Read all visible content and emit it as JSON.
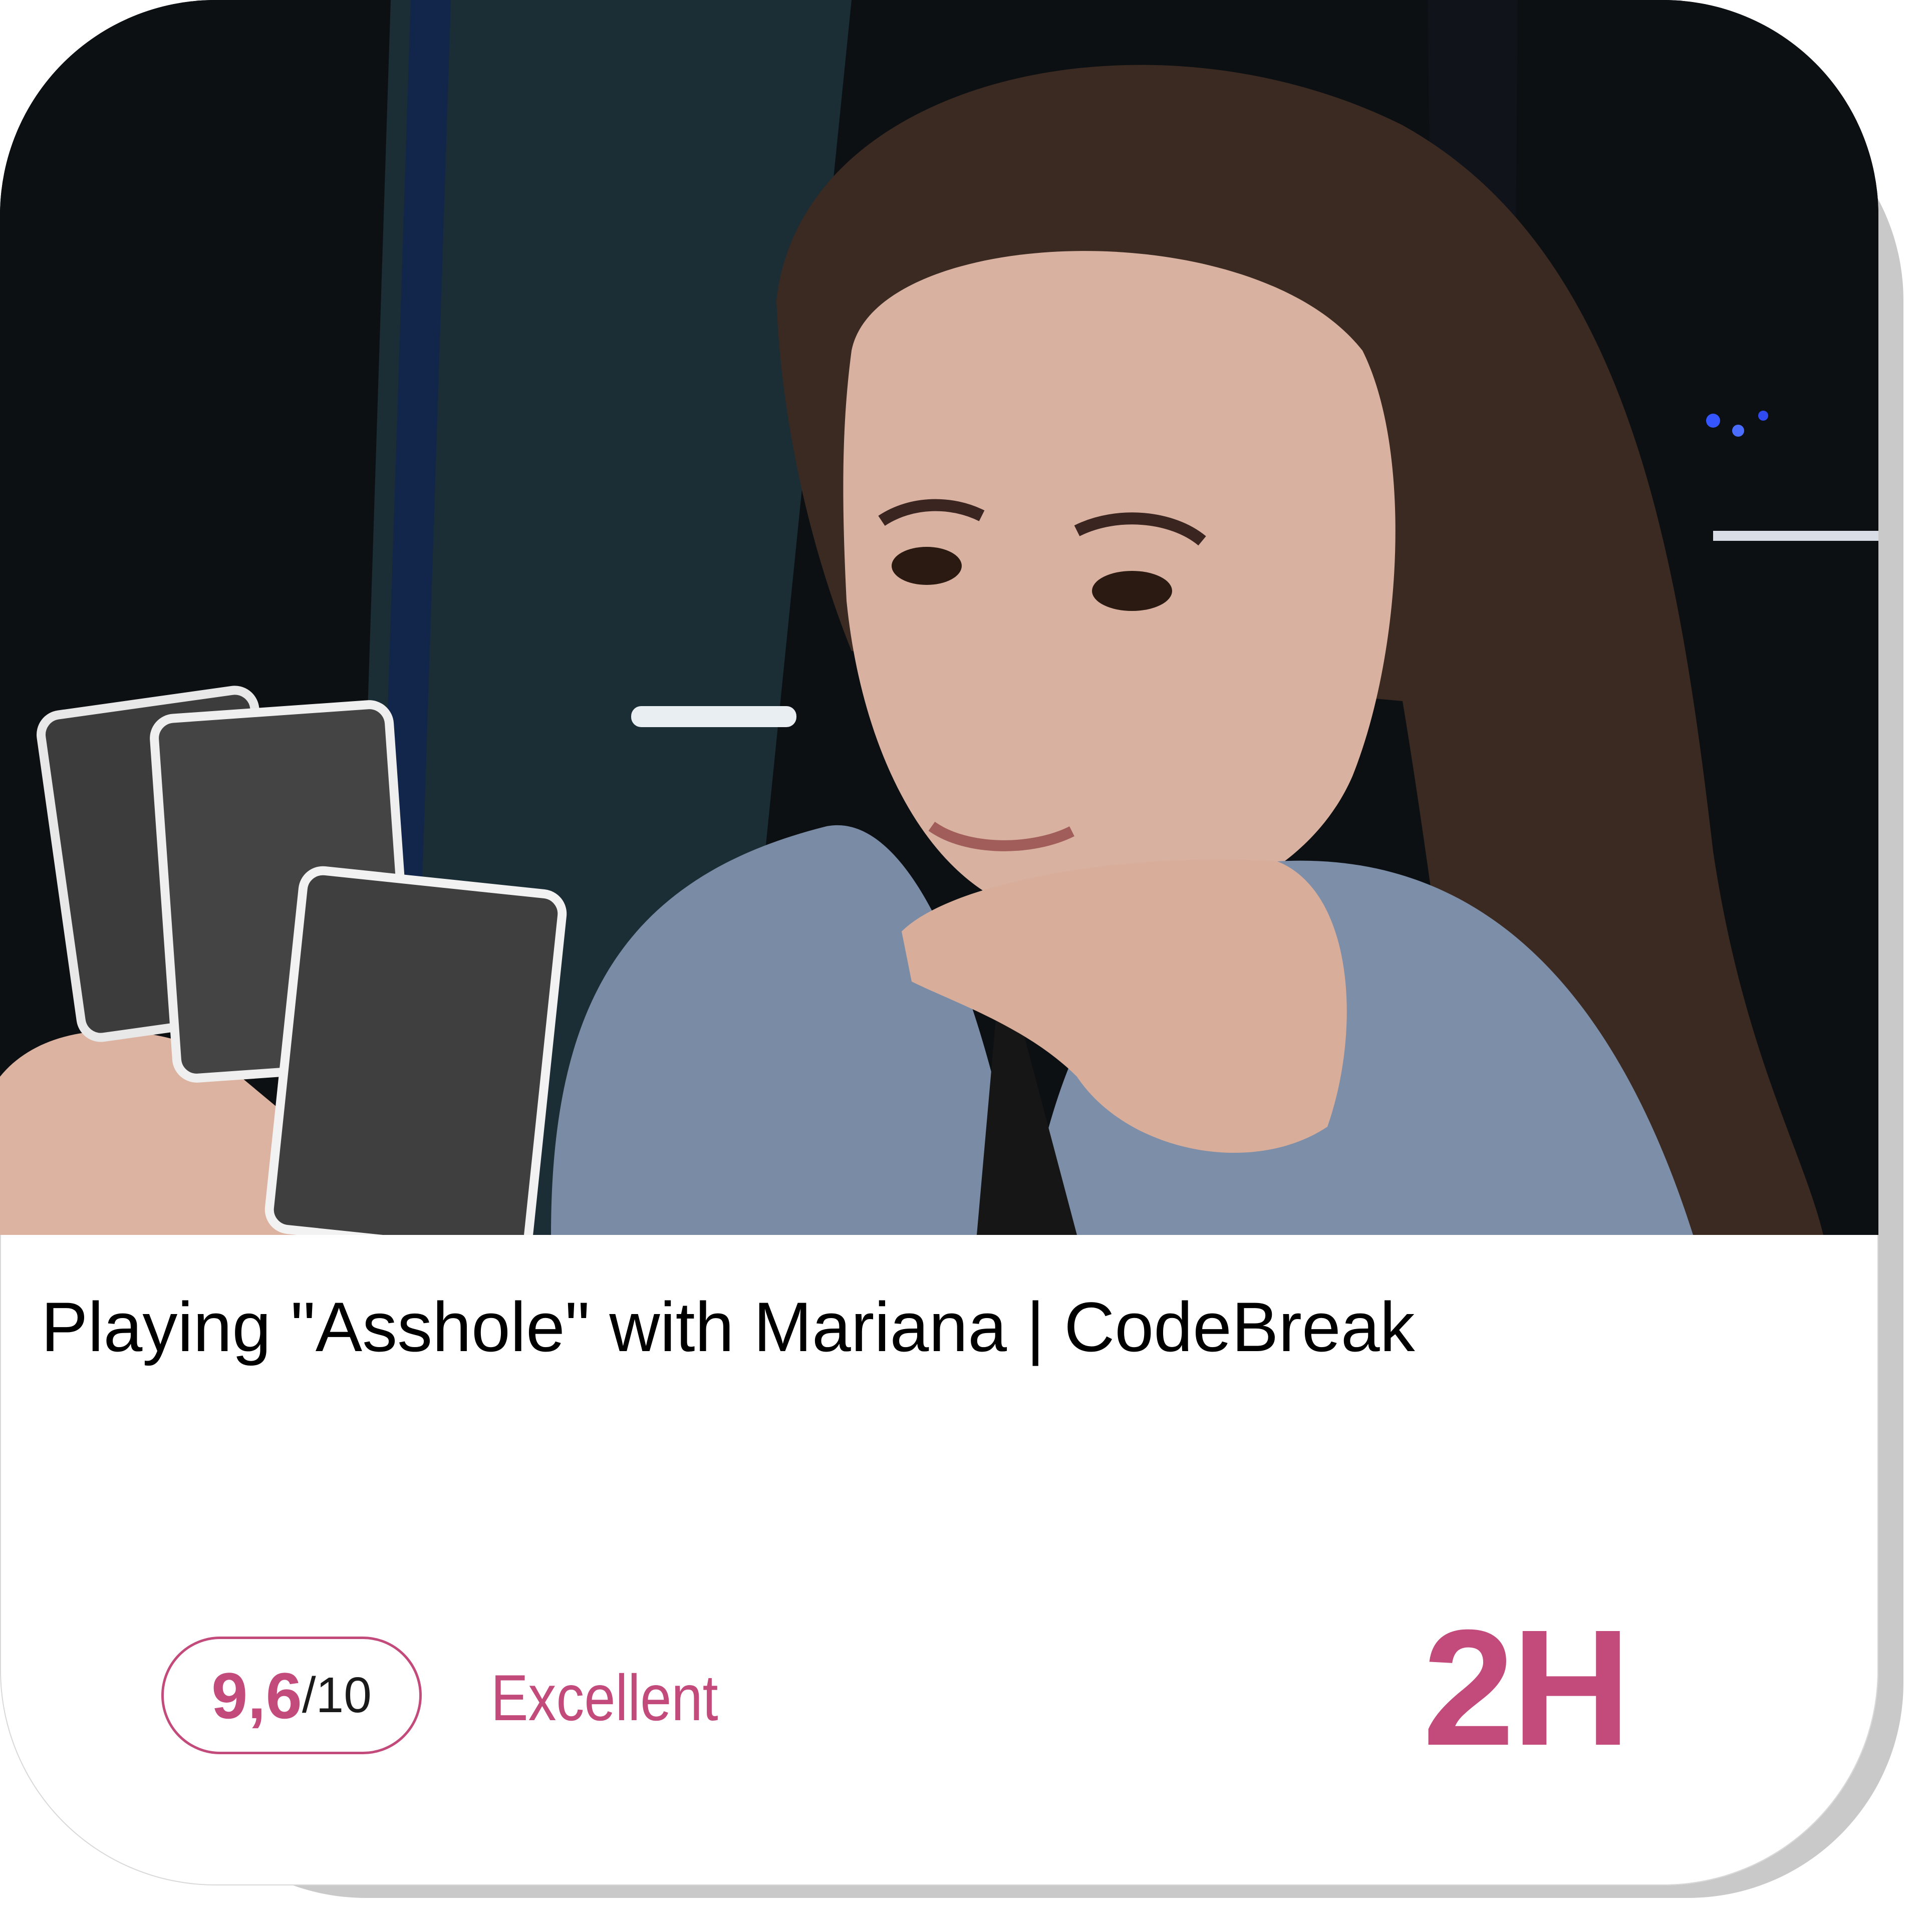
{
  "card": {
    "title": "Playing \"Asshole\" with Mariana | CodeBreak",
    "score_value": "9,6",
    "score_max": "/10",
    "rating_label": "Excellent",
    "duration": "2H"
  },
  "colors": {
    "accent": "#c24b7b",
    "shadow": "#c9c9c9",
    "text": "#000000"
  },
  "photo": {
    "subject": "woman holding playing cards"
  }
}
